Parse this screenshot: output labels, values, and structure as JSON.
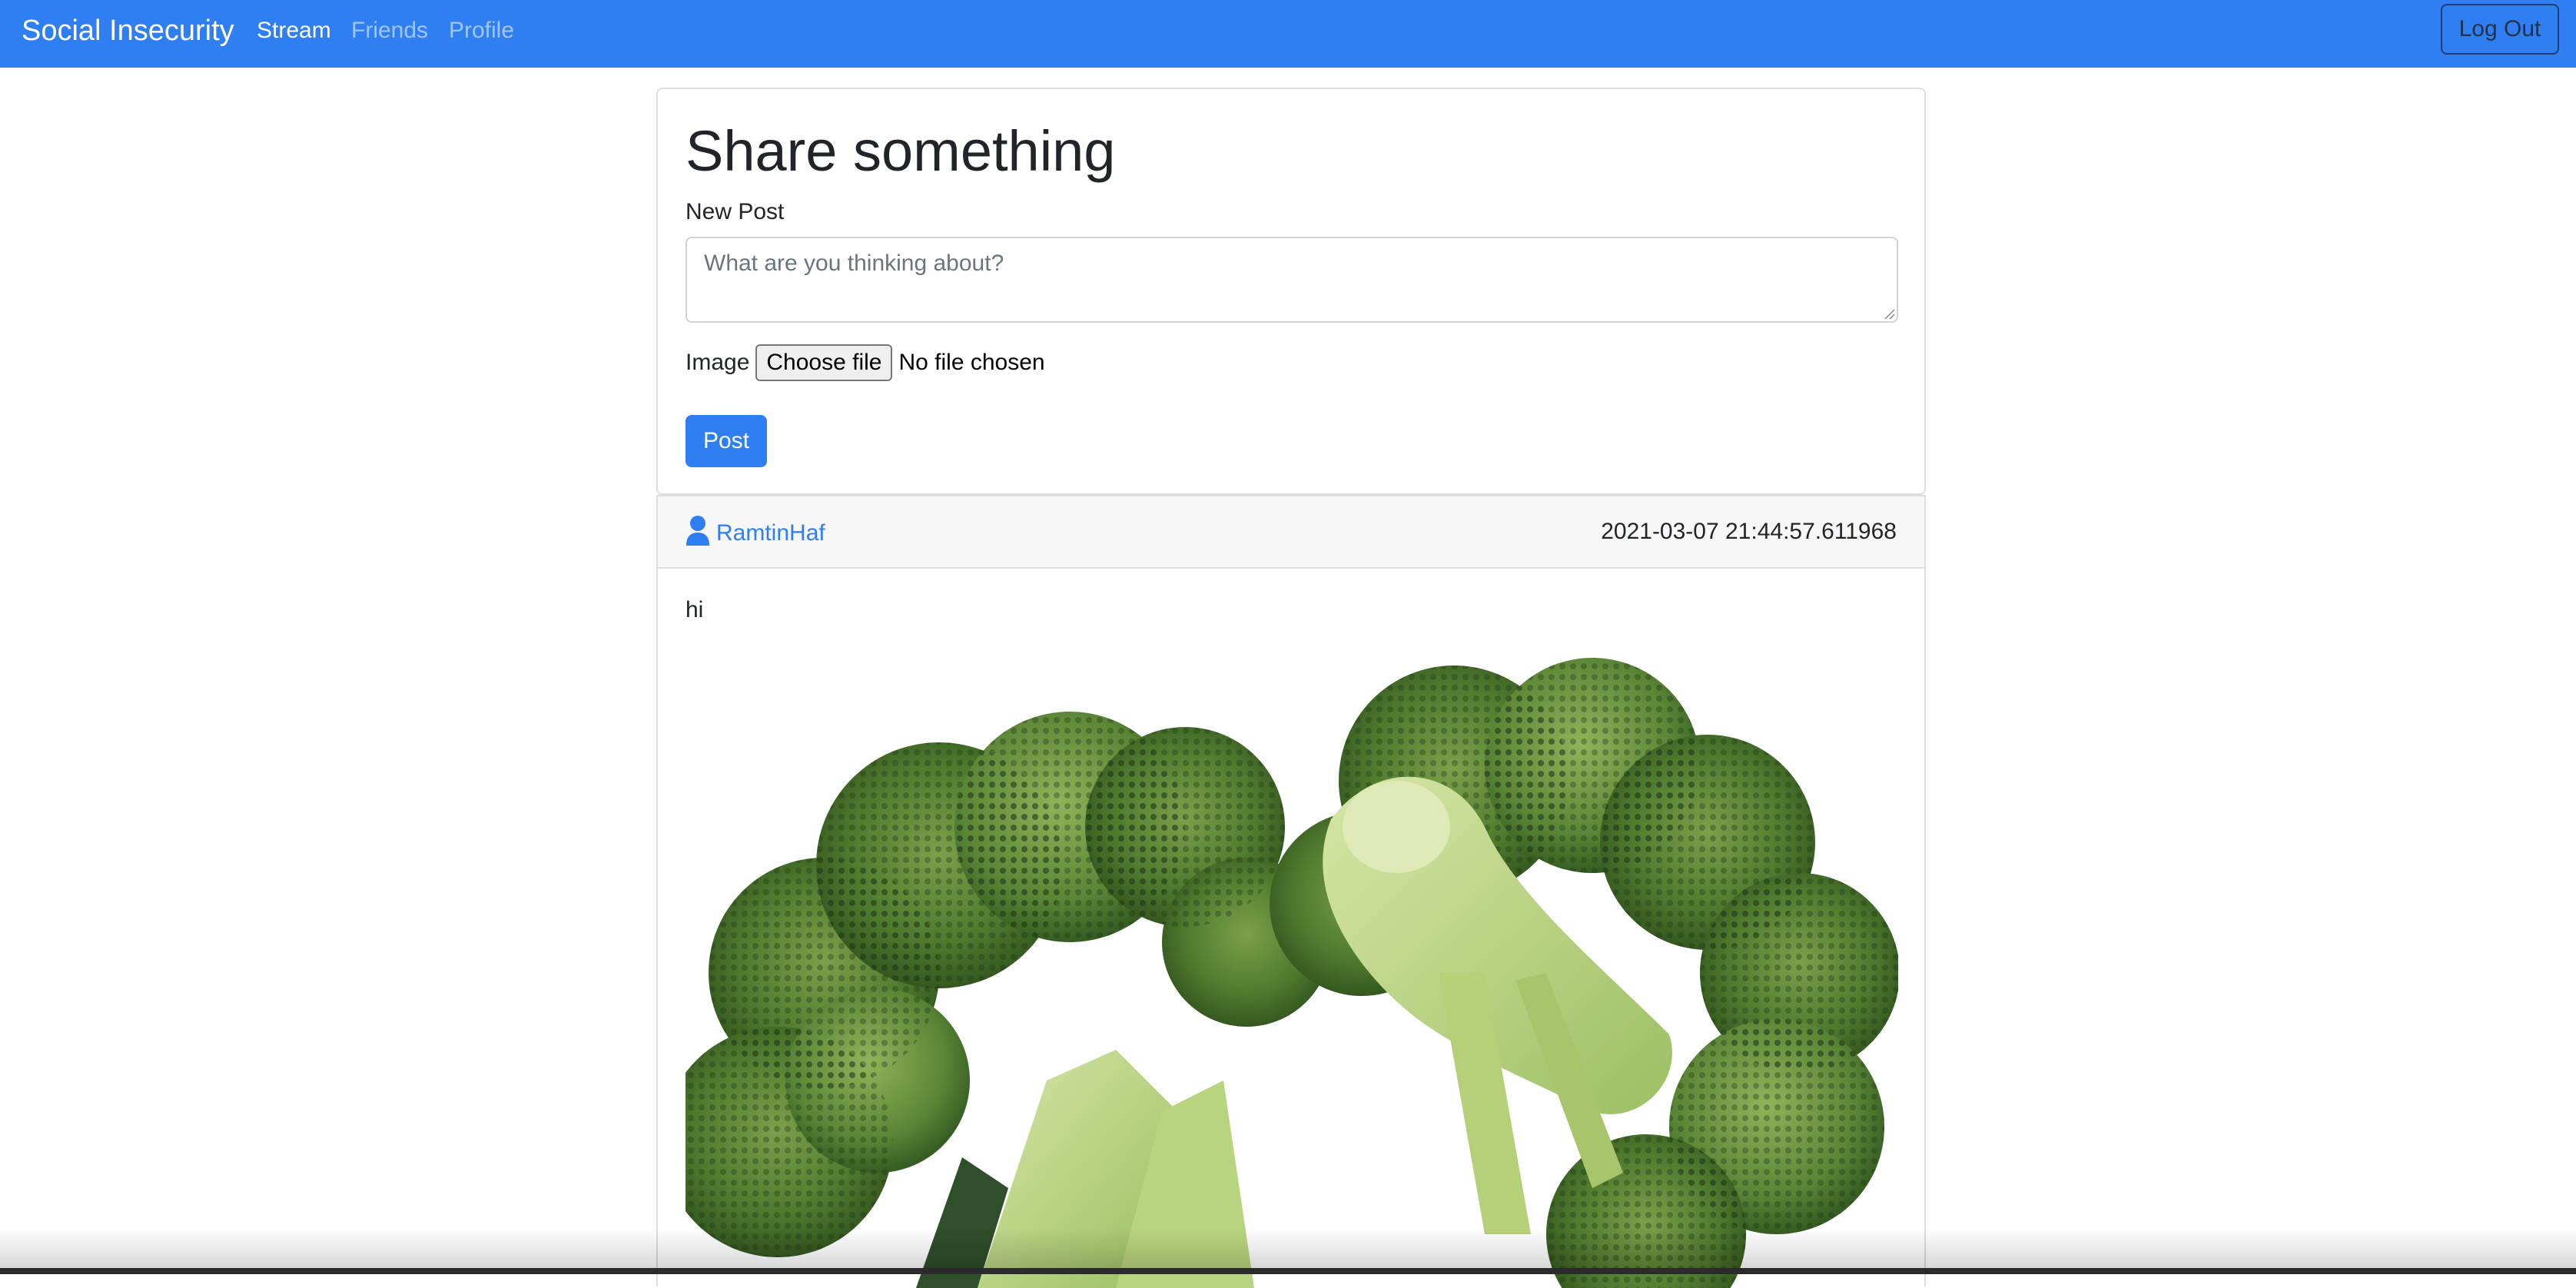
{
  "navbar": {
    "brand": "Social Insecurity",
    "links": [
      {
        "label": "Stream",
        "active": true
      },
      {
        "label": "Friends",
        "active": false
      },
      {
        "label": "Profile",
        "active": false
      }
    ],
    "logout_label": "Log Out",
    "color": "#2f7ff3"
  },
  "compose": {
    "heading": "Share something",
    "new_post_label": "New Post",
    "textarea_placeholder": "What are you thinking about?",
    "textarea_value": "",
    "image_label": "Image",
    "file_button_label": "Choose file",
    "file_status": "No file chosen",
    "submit_label": "Post"
  },
  "posts": [
    {
      "username": "RamtinHaf",
      "timestamp": "2021-03-07 21:44:57.611968",
      "text": "hi",
      "image_subject": "broccoli"
    }
  ],
  "icons": {
    "user": "user-icon"
  }
}
